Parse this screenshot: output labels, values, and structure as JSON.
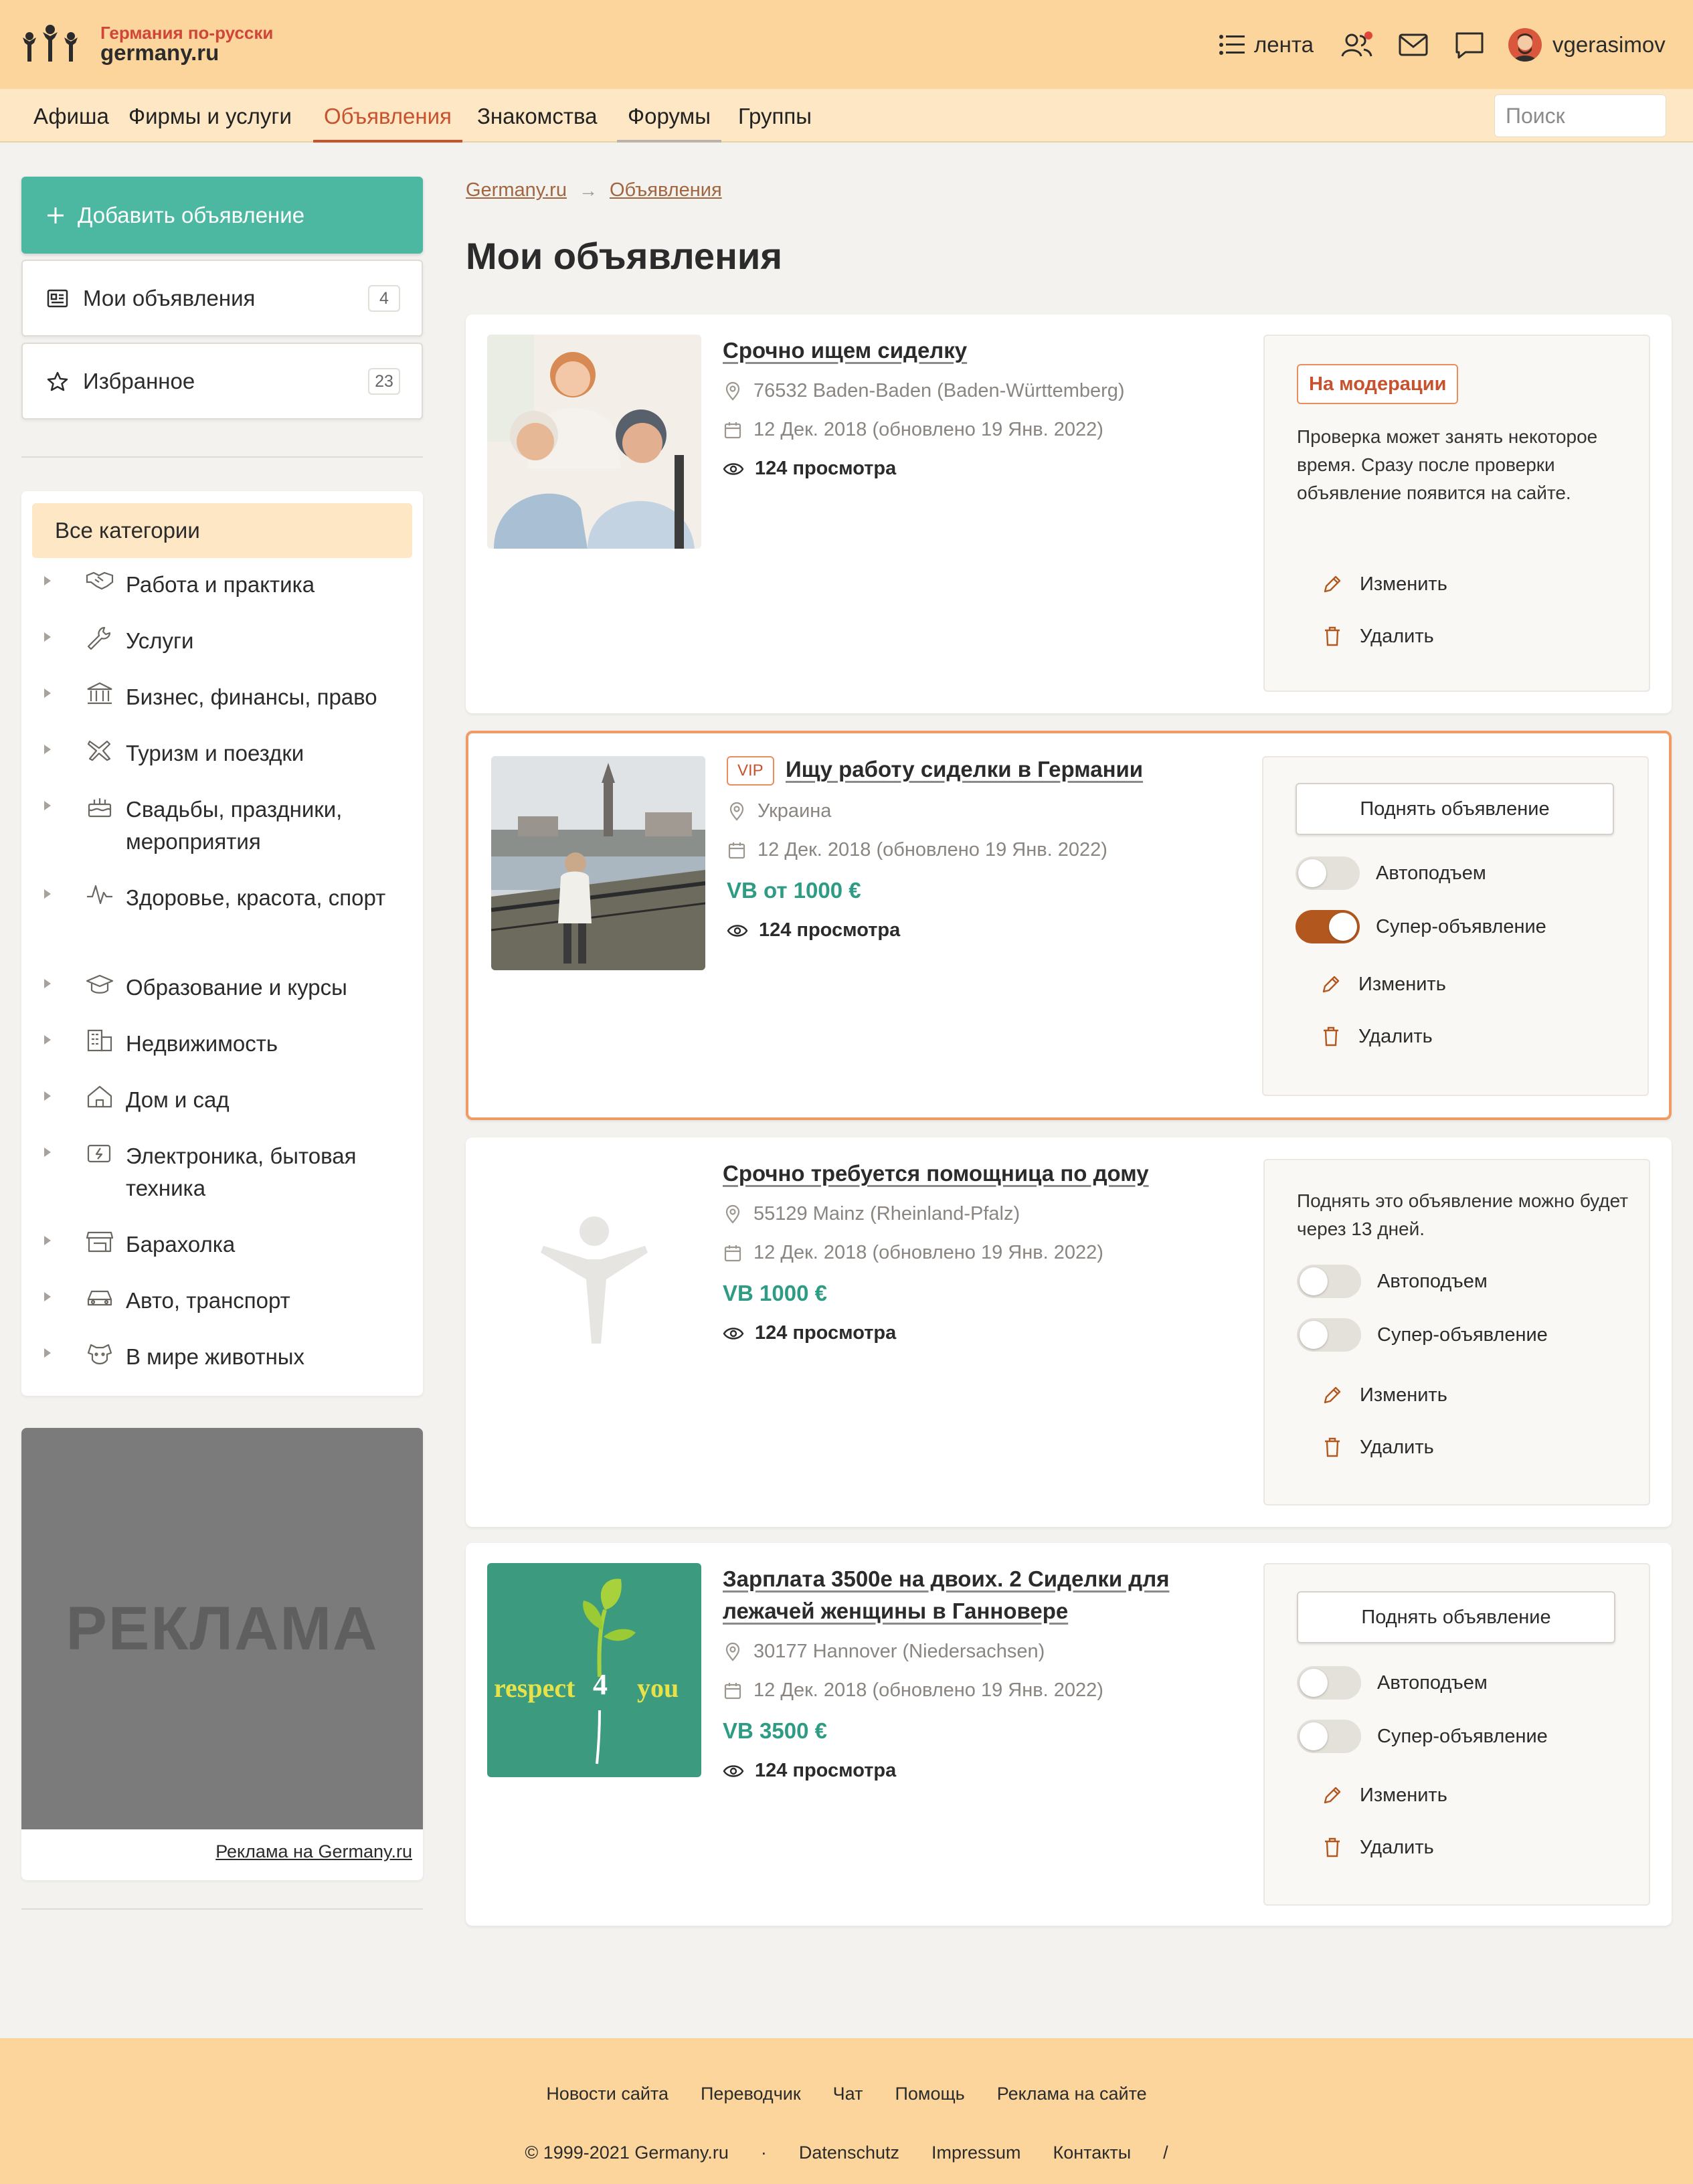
{
  "header": {
    "logo_tag": "Германия по-русски",
    "logo_name": "germany.ru",
    "feed_label": "лента",
    "username": "vgerasimov",
    "notification_color": "#e0463a"
  },
  "nav": {
    "items": [
      "Афиша",
      "Фирмы и услуги",
      "Объявления",
      "Знакомства",
      "Форумы",
      "Группы"
    ],
    "active": "Объявления",
    "search_placeholder": "Поиск"
  },
  "sidebar": {
    "add_label": "Добавить объявление",
    "my_label": "Мои объявления",
    "my_count": "4",
    "fav_label": "Избранное",
    "fav_count": "23",
    "categories_title": "Все категории",
    "categories": [
      {
        "label": "Работа и практика",
        "icon": "handshake-icon"
      },
      {
        "label": "Услуги",
        "icon": "wrench-icon"
      },
      {
        "label": "Бизнес, финансы, право",
        "icon": "bank-icon"
      },
      {
        "label": "Туризм и поездки",
        "icon": "plane-icon"
      },
      {
        "label": "Свадьбы, праздники, мероприятия",
        "icon": "cake-icon"
      },
      {
        "label": "Здоровье, красота, спорт",
        "icon": "pulse-icon"
      },
      {
        "label": "Образование и курсы",
        "icon": "graduation-cap-icon"
      },
      {
        "label": "Недвижимость",
        "icon": "building-icon"
      },
      {
        "label": "Дом и сад",
        "icon": "house-icon"
      },
      {
        "label": "Электроника, бытовая техника",
        "icon": "battery-icon"
      },
      {
        "label": "Барахолка",
        "icon": "shop-icon"
      },
      {
        "label": "Авто, транспорт",
        "icon": "car-icon"
      },
      {
        "label": "В мире животных",
        "icon": "dog-icon"
      }
    ],
    "ad_text": "РЕКЛАМА",
    "ad_link": "Реклама на Germany.ru"
  },
  "breadcrumb": [
    "Germany.ru",
    "Объявления"
  ],
  "page_title": "Мои объявления",
  "listings": [
    {
      "title": "Срочно ищем сиделку",
      "location": "76532 Baden-Baden (Baden-Württemberg)",
      "date": "12 Дек. 2018 (обновлено 19 Янв. 2022)",
      "views": "124 просмотра",
      "status": "На модерации",
      "status_text": "Проверка может занять некоторое время. Сразу после проверки объявление появится на сайте.",
      "edit": "Изменить",
      "delete": "Удалить"
    },
    {
      "vip": "VIP",
      "title": "Ищу работу сиделки в Германии",
      "location": "Украина",
      "date": "12 Дек. 2018 (обновлено 19 Янв. 2022)",
      "price": "VB от 1000 €",
      "views": "124 просмотра",
      "raise": "Поднять объявление",
      "autoraise": "Автоподъем",
      "autoraise_on": false,
      "super": "Супер-объявление",
      "super_on": true,
      "edit": "Изменить",
      "delete": "Удалить"
    },
    {
      "title": "Срочно требуется помощница по дому",
      "location": "55129 Mainz (Rheinland-Pfalz)",
      "date": "12 Дек. 2018 (обновлено 19 Янв. 2022)",
      "price": "VB 1000 €",
      "views": "124 просмотра",
      "raise_note": "Поднять это объявление можно будет через 13 дней.",
      "autoraise": "Автоподъем",
      "autoraise_on": false,
      "super": "Супер-объявление",
      "super_on": false,
      "edit": "Изменить",
      "delete": "Удалить"
    },
    {
      "title": "Зарплата 3500е на двоих. 2 Сиделки для лежачей женщины в Ганновере",
      "location": "30177 Hannover (Niedersachsen)",
      "date": "12 Дек. 2018 (обновлено 19 Янв. 2022)",
      "price": "VB 3500 €",
      "views": "124 просмотра",
      "thumb_logo_left": "respect",
      "thumb_logo_mid": "4",
      "thumb_logo_right": "you",
      "raise": "Поднять объявление",
      "autoraise": "Автоподъем",
      "autoraise_on": false,
      "super": "Супер-объявление",
      "super_on": false,
      "edit": "Изменить",
      "delete": "Удалить"
    }
  ],
  "footer": {
    "links": [
      "Новости сайта",
      "Переводчик",
      "Чат",
      "Помощь",
      "Реклама на сайте"
    ],
    "copyright": "© 1999-2021 Germany.ru",
    "sep": "·",
    "legal": [
      "Datenschutz",
      "Impressum",
      "Контакты"
    ],
    "slash": "/"
  },
  "colors": {
    "header_bg": "#fbd59b",
    "nav_bg": "#fde7c4",
    "accent": "#c8522e",
    "teal": "#4db8a1",
    "price": "#2e9b84",
    "vip_border": "#f09a66",
    "toggle_on": "#b2581f"
  }
}
